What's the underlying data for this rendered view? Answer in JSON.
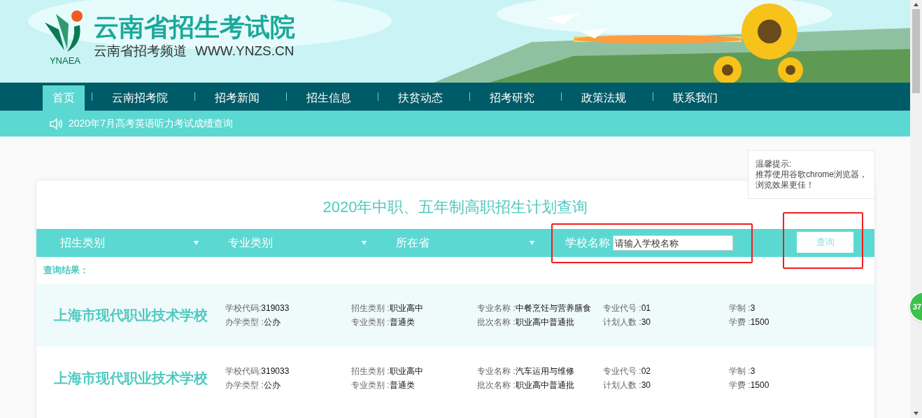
{
  "header": {
    "logo_text": "YNAEA",
    "title": "云南省招生考试院",
    "subtitle": "云南省招考频道",
    "url": "WWW.YNZS.CN"
  },
  "nav": [
    {
      "label": "首页",
      "selected": true
    },
    {
      "label": "云南招考院",
      "selected": false
    },
    {
      "label": "招考新闻",
      "selected": false
    },
    {
      "label": "招生信息",
      "selected": false
    },
    {
      "label": "扶贫动态",
      "selected": false
    },
    {
      "label": "招考研究",
      "selected": false
    },
    {
      "label": "政策法规",
      "selected": false
    },
    {
      "label": "联系我们",
      "selected": false
    }
  ],
  "notice": "2020年7月高考英语听力考试成绩查询",
  "tip": {
    "title": "温馨提示:",
    "text": "推荐使用谷歌chrome浏览器，浏览效果更佳！"
  },
  "page_title": "2020年中职、五年制高职招生计划查询",
  "filters": [
    {
      "label": "招生类别"
    },
    {
      "label": "专业类别"
    },
    {
      "label": "所在省"
    }
  ],
  "school_field": {
    "label": "学校名称",
    "placeholder": "请输入学校名称"
  },
  "search_button": "查询",
  "results_label": "查询结果：",
  "results": [
    {
      "school": "上海市现代职业技术学校",
      "fields": [
        {
          "label": "学校代码:",
          "value": "319033"
        },
        {
          "label": "办学类型 :",
          "value": "公办"
        },
        {
          "label": "招生类别 :",
          "value": "职业高中"
        },
        {
          "label": "专业类别 :",
          "value": "普通类"
        },
        {
          "label": "专业名称 :",
          "value": "中餐烹饪与营养膳食"
        },
        {
          "label": "批次名称 :",
          "value": "职业高中普通批"
        },
        {
          "label": "专业代号 :",
          "value": "01"
        },
        {
          "label": "计划人数 :",
          "value": "30"
        },
        {
          "label": "学制 :",
          "value": "3"
        },
        {
          "label": "学费 :",
          "value": "1500"
        }
      ]
    },
    {
      "school": "上海市现代职业技术学校",
      "fields": [
        {
          "label": "学校代码:",
          "value": "319033"
        },
        {
          "label": "办学类型 :",
          "value": "公办"
        },
        {
          "label": "招生类别 :",
          "value": "职业高中"
        },
        {
          "label": "专业类别 :",
          "value": "普通类"
        },
        {
          "label": "专业名称 :",
          "value": "汽车运用与维修"
        },
        {
          "label": "批次名称 :",
          "value": "职业高中普通批"
        },
        {
          "label": "专业代号 :",
          "value": "02"
        },
        {
          "label": "计划人数 :",
          "value": "30"
        },
        {
          "label": "学制 :",
          "value": "3"
        },
        {
          "label": "学费 :",
          "value": "1500"
        }
      ]
    }
  ],
  "float_badge": "37"
}
